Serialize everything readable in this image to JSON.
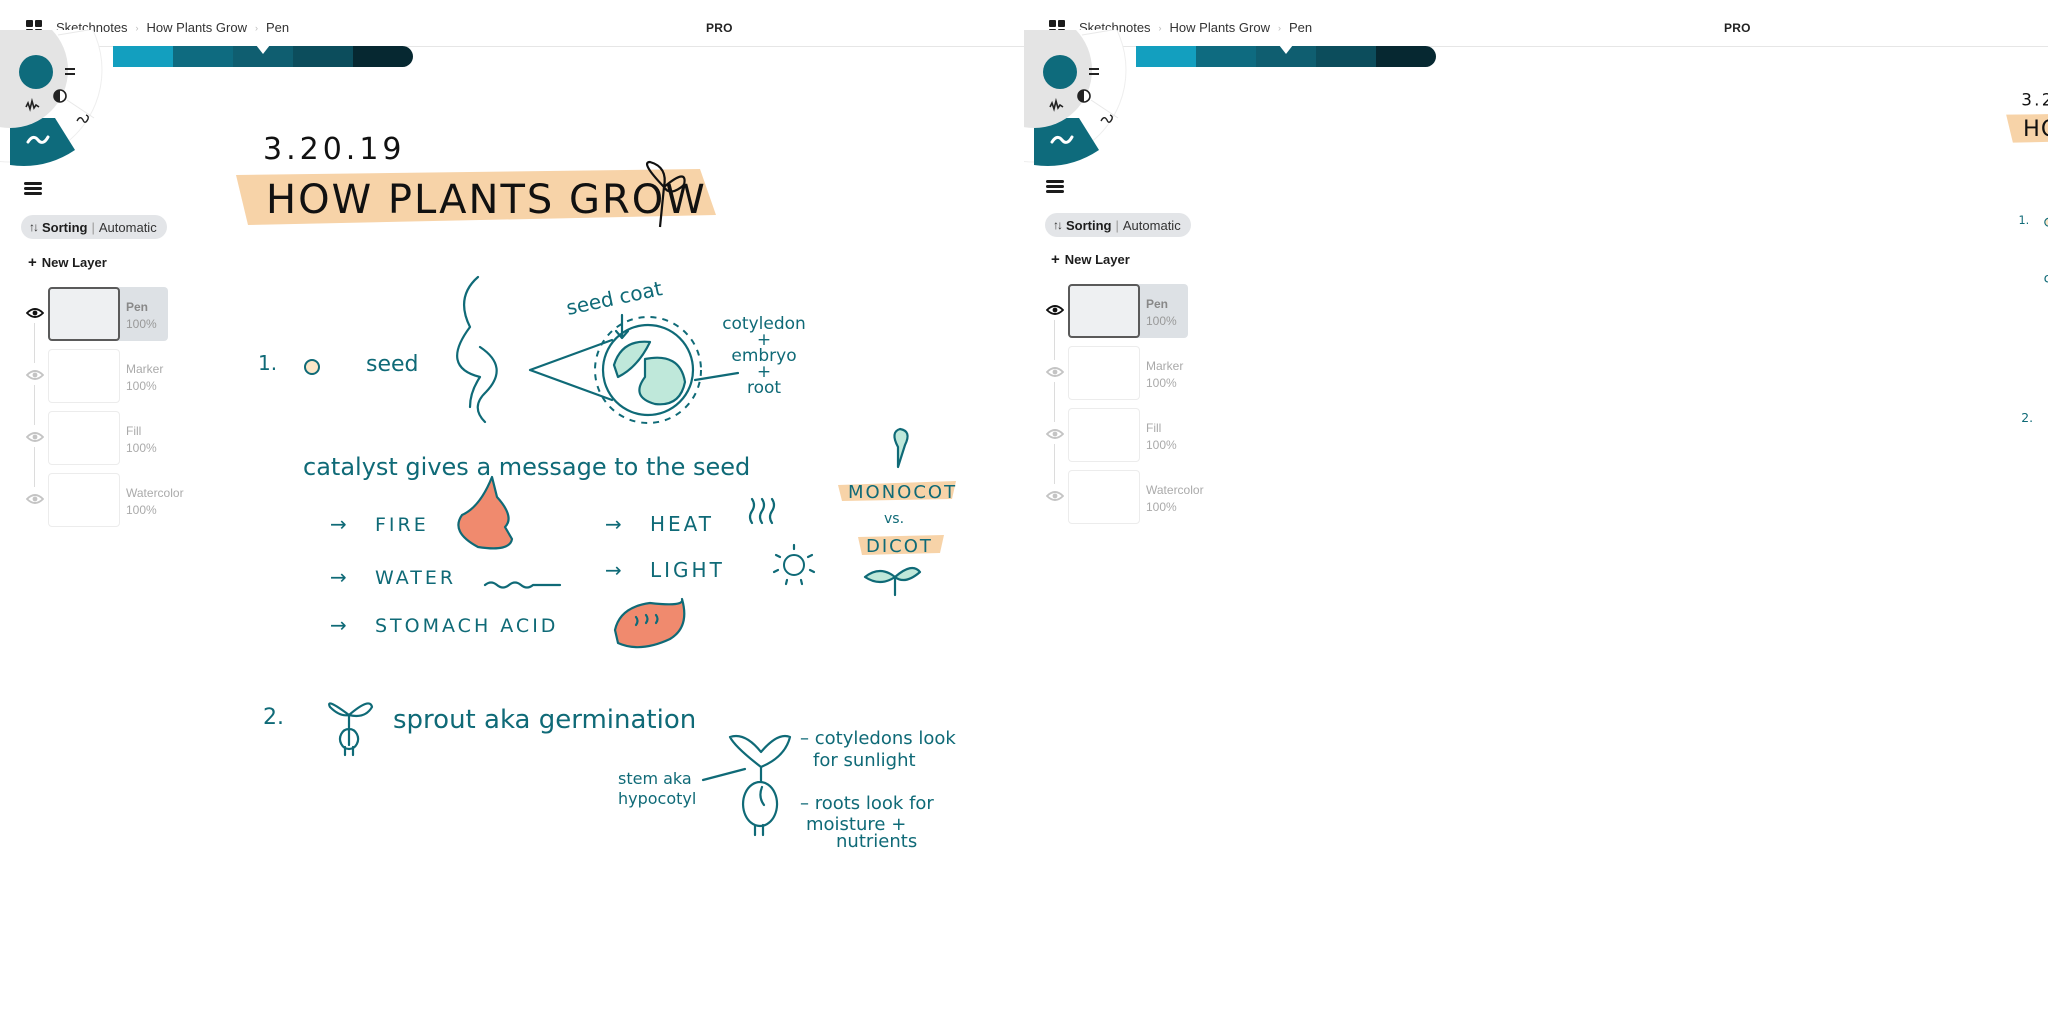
{
  "app": {
    "pro_label": "PRO",
    "breadcrumb": [
      "Sketchnotes",
      "How Plants Grow",
      "Pen"
    ]
  },
  "colors": {
    "ink": "#0f6a77",
    "accent": "#0e6b7c",
    "highlight": "#f7d3a8",
    "flame": "#f08a6e",
    "leaf": "#bfe8da",
    "palette": [
      "#139fbf",
      "#0e6b80",
      "#0f5e70",
      "#0c4d5c",
      "#062831"
    ],
    "selected_swatch_index": 2
  },
  "tool_wheel": {
    "current_color": "#0e6b7c",
    "icons": [
      "menu-equals-icon",
      "opacity-icon",
      "brush-texture-icon",
      "pen-stroke-icon",
      "selected-tool-icon"
    ]
  },
  "layers_panel": {
    "sorting_label": "Sorting",
    "sorting_value": "Automatic",
    "sorting_icon": "↑↓",
    "new_layer_label": "New Layer",
    "layers": [
      {
        "name": "Pen",
        "opacity": "100%",
        "visible": true,
        "active": true
      },
      {
        "name": "Marker",
        "opacity": "100%",
        "visible": false,
        "active": false
      },
      {
        "name": "Fill",
        "opacity": "100%",
        "visible": false,
        "active": false
      },
      {
        "name": "Watercolor",
        "opacity": "100%",
        "visible": false,
        "active": false
      }
    ]
  },
  "sketch": {
    "date": "3.20.19",
    "title": "HOW PLANTS GROW",
    "section1_number": "1.",
    "section1_label": "seed",
    "seed_coat_label": "seed coat",
    "embryo_label": [
      "cotyledon",
      "+",
      "embryo",
      "+",
      "root"
    ],
    "catalyst_line": "catalyst gives a message to the seed",
    "catalysts_left": [
      "FIRE",
      "WATER",
      "STOMACH ACID"
    ],
    "catalysts_right": [
      "HEAT",
      "LIGHT"
    ],
    "arrow": "→",
    "monocot": "MONOCOT",
    "vs": "vs.",
    "dicot": "DICOT",
    "section2_number": "2.",
    "section2_label": "sprout aka germination",
    "stem_label": [
      "stem aka",
      "hypocotyl"
    ],
    "cotyledons_note": [
      "– cotyledons look",
      "for sunlight"
    ],
    "roots_note": [
      "– roots look for",
      "moisture +",
      "nutrients"
    ]
  }
}
